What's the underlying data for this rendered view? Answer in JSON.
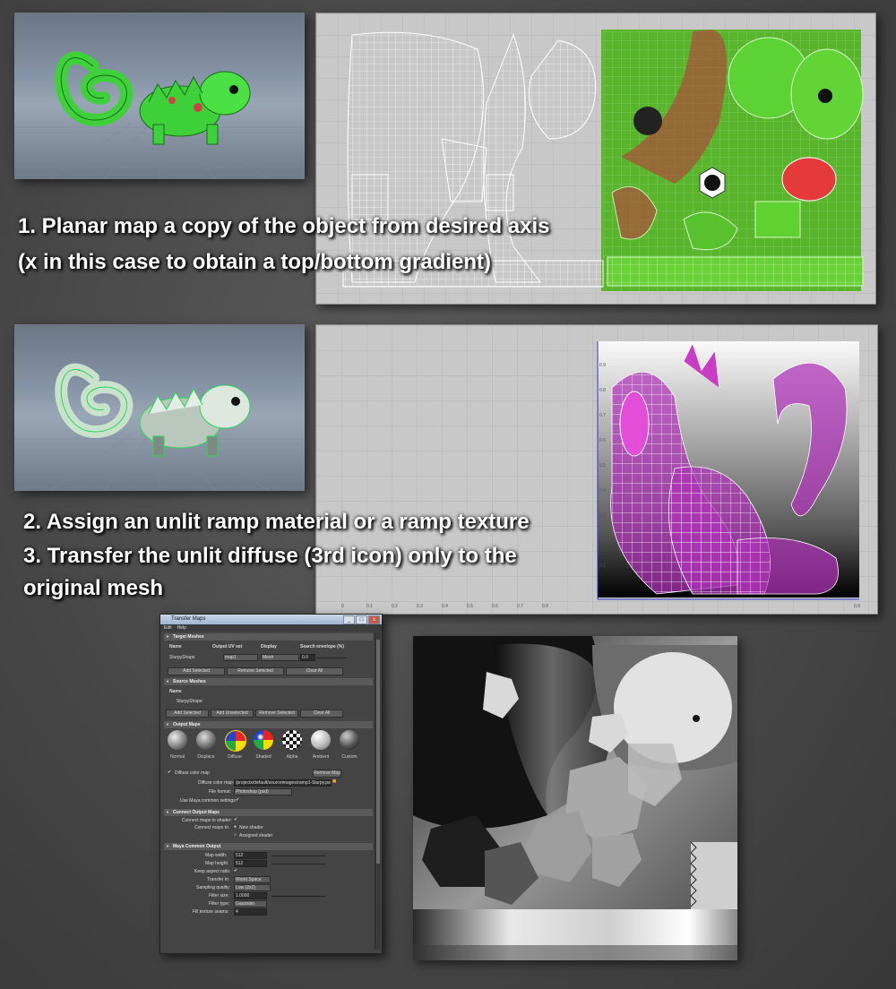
{
  "captions": {
    "step1_line1": "1. Planar map a copy of the object from desired axis",
    "step1_line2": "(x in this case to obtain a top/bottom gradient)",
    "step2_line1": "2. Assign an unlit ramp material or a ramp texture",
    "step3_line1": "3. Transfer the unlit diffuse (3rd icon) only to the",
    "step3_line2": "original mesh"
  },
  "uv_axis_labels": {
    "y": [
      "0.9",
      "0.8",
      "0.7",
      "0.6",
      "0.5",
      "0.4",
      "0.3",
      "0.2",
      "0.1"
    ],
    "x": [
      "0",
      "0.1",
      "0.2",
      "0.3",
      "0.4",
      "0.5",
      "0.6",
      "0.7",
      "0.8",
      "0.9"
    ]
  },
  "transfer_window": {
    "title": "Transfer Maps",
    "window_buttons": [
      "_",
      "□",
      "x"
    ],
    "menu": [
      "Edit",
      "Help"
    ],
    "target": {
      "header": "Target Meshes",
      "columns": [
        "Name",
        "Output UV set",
        "Display",
        "Search envelope (%)"
      ],
      "row": {
        "name": "SlurpyShape",
        "uv_set": "map1",
        "display": "Mesh",
        "envelope": "0.0"
      },
      "buttons": [
        "Add Selected",
        "Remove Selected",
        "Clear All"
      ]
    },
    "source": {
      "header": "Source Meshes",
      "column": "Name",
      "row": "SlurpyShape",
      "buttons": [
        "Add Selected",
        "Add Unselected",
        "Remove Selected",
        "Clear All"
      ]
    },
    "output": {
      "header": "Output Maps",
      "maps": [
        "Normal",
        "Displace",
        "Diffuse",
        "Shaded",
        "Alpha",
        "Ambient",
        "Custom"
      ],
      "diffuse_check_label": "Diffuse color map",
      "remove_button": "Remove Map",
      "color_map_label": "Diffuse color map:",
      "color_map_value": "/projects/default/sourceimages/ramp1-Slurpy.psd",
      "format_label": "File format:",
      "format_value": "Photoshop (psd)",
      "common_label": "Use Maya common settings"
    },
    "connect": {
      "header": "Connect Output Maps",
      "shader_label": "Connect maps to shader:",
      "maps_to_label": "Connect maps to:",
      "options": [
        "New shader",
        "Assigned shader"
      ]
    },
    "common": {
      "header": "Maya Common Output",
      "map_width_label": "Map width:",
      "map_width": "512",
      "map_height_label": "Map height:",
      "map_height": "512",
      "aspect_label": "Keep aspect ratio:",
      "transfer_label": "Transfer in:",
      "transfer_value": "World Space",
      "quality_label": "Sampling quality:",
      "quality_value": "Low (2x2)",
      "filter_size_label": "Filter size:",
      "filter_size": "1.0000",
      "filter_type_label": "Filter type:",
      "filter_type": "Gaussian",
      "fill_label": "Fill texture seams:",
      "fill_value": "4"
    }
  },
  "colors": {
    "chameleon_green": "#3fd13a",
    "ramp_magenta": "#c044c8",
    "ui_dark": "#444444"
  }
}
